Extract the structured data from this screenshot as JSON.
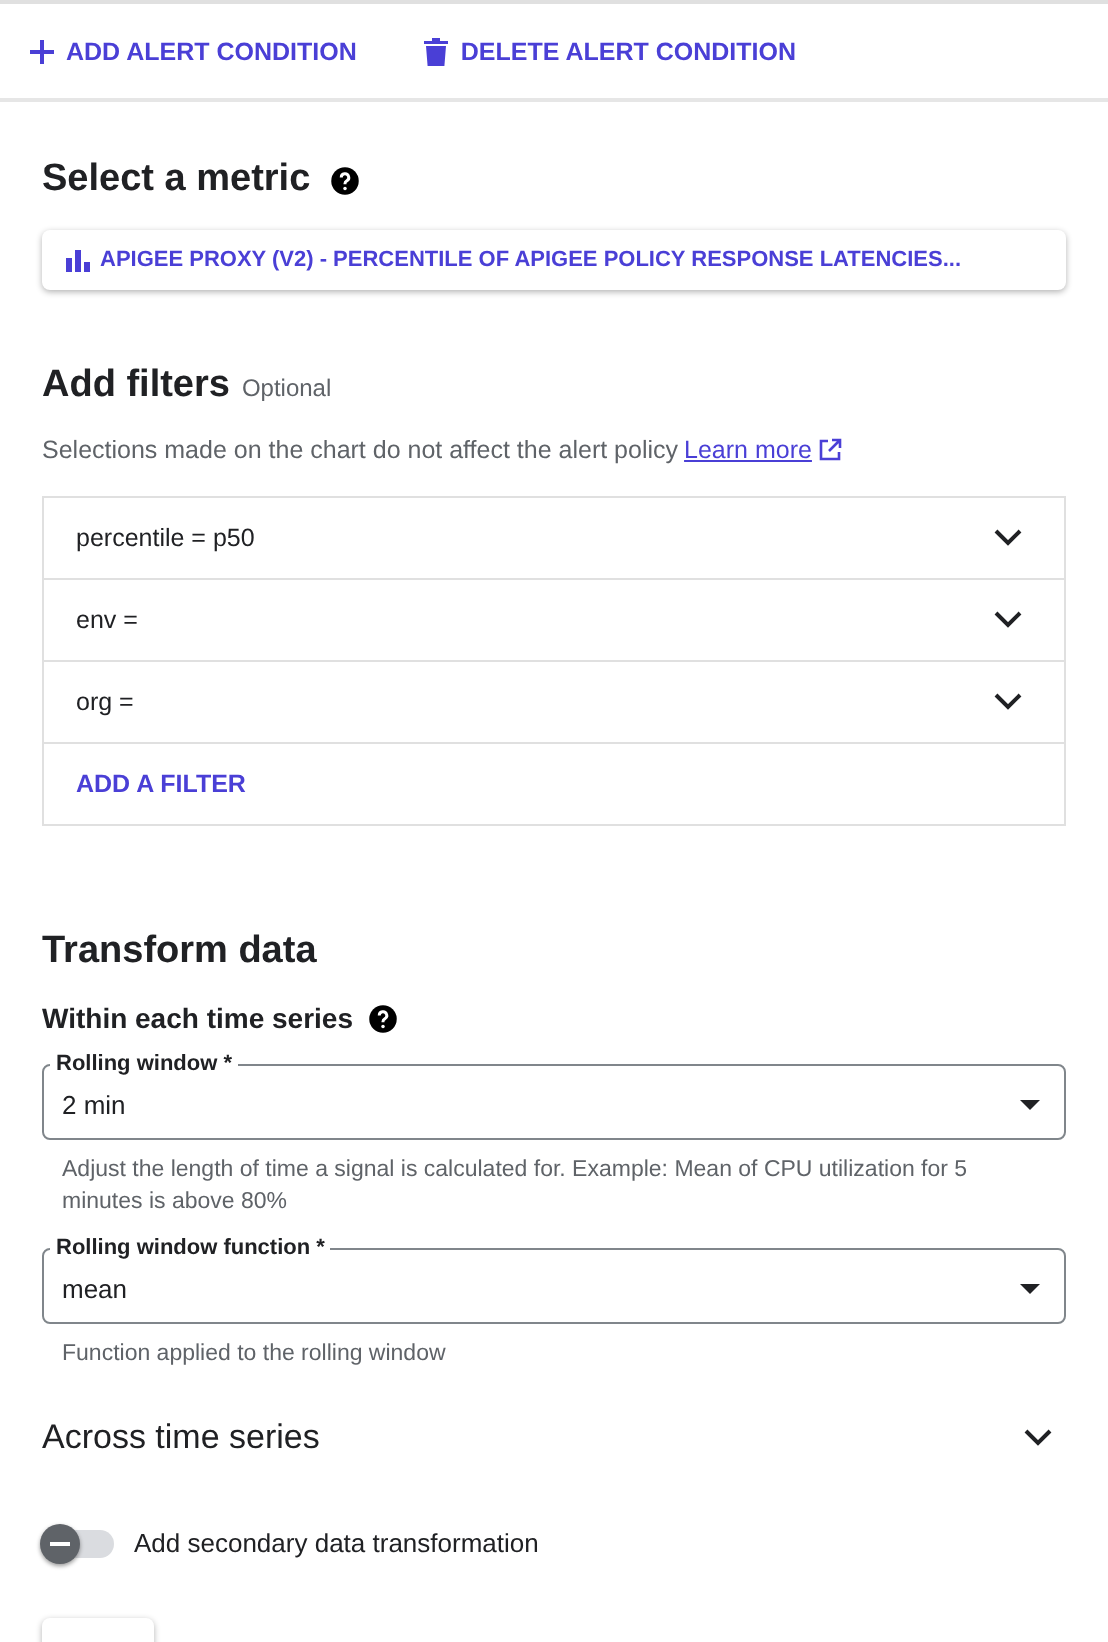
{
  "toolbar": {
    "add_button": "ADD ALERT CONDITION",
    "delete_button": "DELETE ALERT CONDITION"
  },
  "metric": {
    "title": "Select a metric",
    "button": "APIGEE PROXY (V2) - PERCENTILE OF APIGEE POLICY RESPONSE LATENCIES..."
  },
  "filters": {
    "title": "Add filters",
    "optional": "Optional",
    "help": "Selections made on the chart do not affect the alert policy",
    "learn_more": "Learn more",
    "items": [
      {
        "label": "percentile = p50"
      },
      {
        "label": "env ="
      },
      {
        "label": "org ="
      }
    ],
    "add_filter": "ADD A FILTER"
  },
  "transform": {
    "title": "Transform data",
    "within_title": "Within each time series",
    "fields": [
      {
        "label": "Rolling window *",
        "value": "2 min",
        "hint": "Adjust the length of time a signal is calculated for. Example: Mean of CPU utilization for 5 minutes is above 80%"
      },
      {
        "label": "Rolling window function *",
        "value": "mean",
        "hint": "Function applied to the rolling window"
      }
    ],
    "across_title": "Across time series",
    "across_expanded": false,
    "secondary_toggle": {
      "label": "Add secondary data transformation",
      "on": false
    }
  }
}
